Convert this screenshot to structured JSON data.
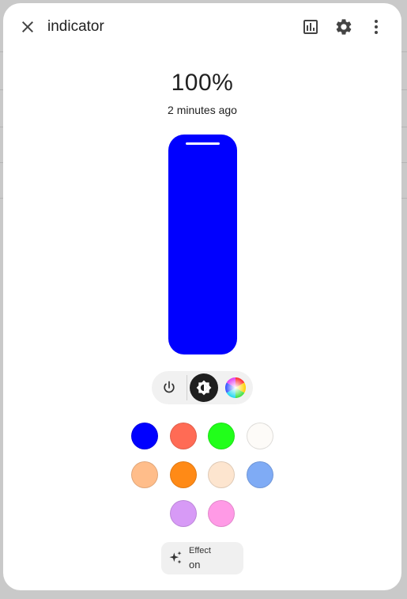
{
  "dialog": {
    "title": "indicator",
    "close_icon": "close-icon",
    "history_icon": "chart-box-icon",
    "settings_icon": "gear-icon",
    "menu_icon": "more-vertical-icon"
  },
  "state": {
    "value": "100%",
    "last_changed": "2 minutes ago"
  },
  "brightness": {
    "level_percent": 100,
    "fill_color": "#0000ff"
  },
  "mode_bar": {
    "buttons": [
      {
        "icon": "power-icon",
        "active": false
      },
      {
        "icon": "brightness-icon",
        "active": true
      },
      {
        "icon": "color-wheel-icon",
        "active": false
      }
    ]
  },
  "color_presets": [
    {
      "color": "#0000ff"
    },
    {
      "color": "#ff6b55"
    },
    {
      "color": "#21ff1a"
    },
    {
      "color": "#fdfbf8"
    },
    {
      "color": "#ffbd8a"
    },
    {
      "color": "#ff8a16"
    },
    {
      "color": "#fde5cf"
    },
    {
      "color": "#7fabf5"
    },
    {
      "color": "#d79af6"
    },
    {
      "color": "#ff9ae6"
    }
  ],
  "effect": {
    "icon": "sparkles-icon",
    "label": "Effect",
    "value": "on"
  }
}
